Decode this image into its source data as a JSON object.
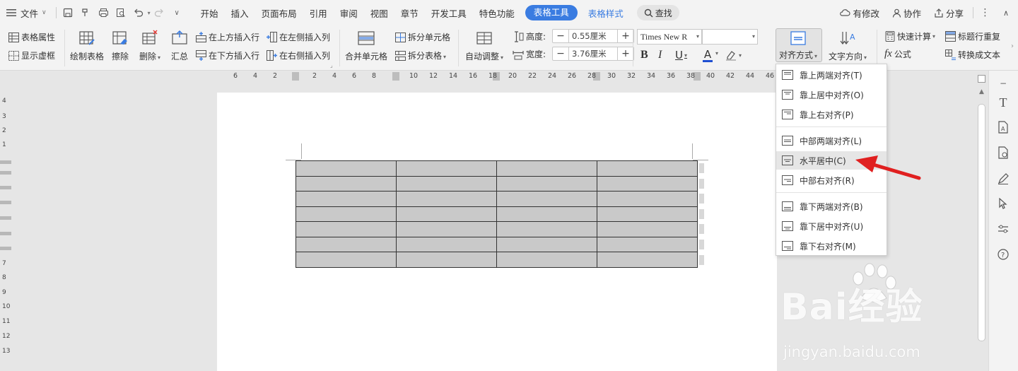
{
  "menubar": {
    "file_label": "文件",
    "tabs": [
      "开始",
      "插入",
      "页面布局",
      "引用",
      "审阅",
      "视图",
      "章节",
      "开发工具",
      "特色功能"
    ],
    "active_tab": "表格工具",
    "style_tab": "表格样式",
    "search_label": "查找",
    "right": {
      "changes": "有修改",
      "collab": "协作",
      "share": "分享"
    }
  },
  "ribbon": {
    "table_props": "表格属性",
    "show_gridlines": "显示虚框",
    "draw_table": "绘制表格",
    "erase": "擦除",
    "delete": "删除",
    "summary": "汇总",
    "insert_above": "在上方插入行",
    "insert_below": "在下方插入行",
    "insert_left": "在左侧插入列",
    "insert_right": "在右侧插入列",
    "merge_cells": "合并单元格",
    "split_cells": "拆分单元格",
    "split_table": "拆分表格",
    "autofit": "自动调整",
    "height_label": "高度:",
    "height_value": "0.55厘米",
    "width_label": "宽度:",
    "width_value": "3.76厘米",
    "font_name": "Times New R",
    "font_size": "",
    "align_mode": "对齐方式",
    "text_direction": "文字方向",
    "quick_calc": "快速计算",
    "repeat_header": "标题行重复",
    "formula": "公式",
    "convert_text": "转换成文本"
  },
  "ruler": {
    "ticks": [
      "6",
      "4",
      "2",
      "2",
      "4",
      "6",
      "8",
      "10",
      "12",
      "14",
      "16",
      "18",
      "20",
      "22",
      "24",
      "26",
      "28",
      "30",
      "32",
      "34",
      "36",
      "38",
      "40",
      "42",
      "44",
      "46"
    ],
    "vticks": [
      "4",
      "3",
      "2",
      "1",
      "7",
      "8",
      "9",
      "10",
      "11",
      "12",
      "13"
    ]
  },
  "table": {
    "rows": 7,
    "cols": 4
  },
  "dropdown": {
    "items": [
      {
        "label": "靠上两端对齐(T)"
      },
      {
        "label": "靠上居中对齐(O)"
      },
      {
        "label": "靠上右对齐(P)"
      },
      {
        "label": "中部两端对齐(L)"
      },
      {
        "label": "水平居中(C)"
      },
      {
        "label": "中部右对齐(R)"
      },
      {
        "label": "靠下两端对齐(B)"
      },
      {
        "label": "靠下居中对齐(U)"
      },
      {
        "label": "靠下右对齐(M)"
      }
    ],
    "highlighted_index": 4
  },
  "watermark": {
    "brand": "Bai经验",
    "url": "jingyan.baidu.com"
  },
  "colors": {
    "accent": "#3a7ce1",
    "arrow": "#e02020",
    "font_color": "#1f4fd1"
  }
}
